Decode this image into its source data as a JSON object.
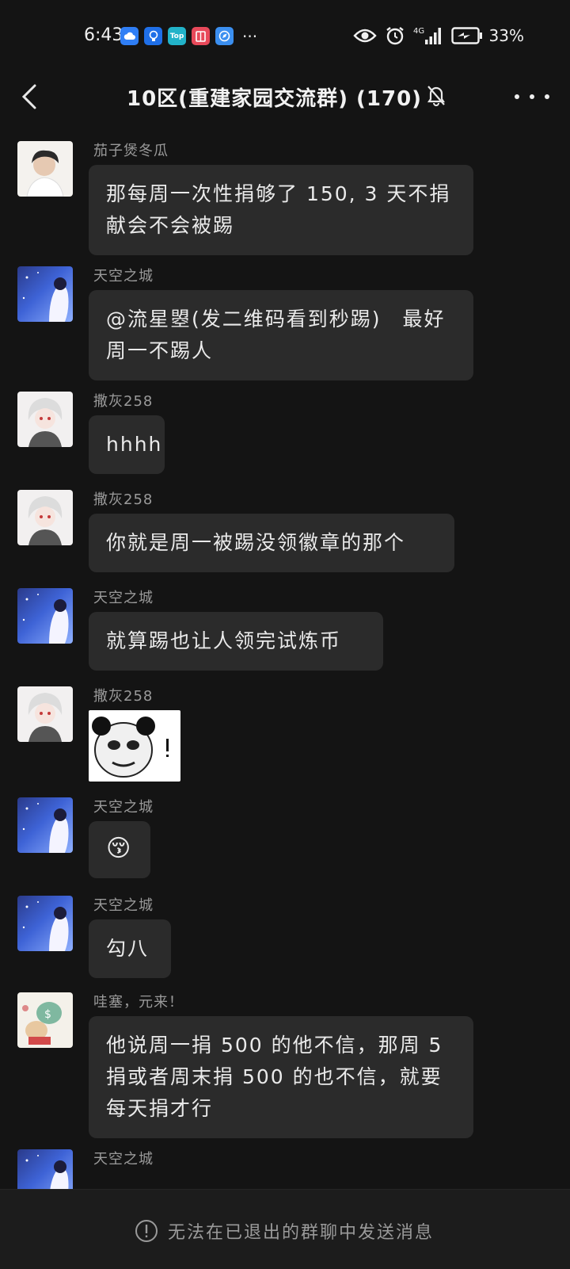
{
  "status_bar": {
    "time": "6:43",
    "network": "4G",
    "battery_text": "33%",
    "app_icons": [
      "cloud-app-icon",
      "lightbulb-app-icon",
      "top-app-icon",
      "notebook-app-icon",
      "compass-app-icon"
    ],
    "more_dots": "···"
  },
  "header": {
    "title": "10区(重建家园交流群) (170)",
    "back_icon": "back-arrow-icon",
    "mute_icon": "bell-off-icon",
    "more_icon": "more-icon"
  },
  "messages": [
    {
      "sender": "茄子煲冬瓜",
      "text": "那每周一次性捐够了 150, 3 天不捐献会不会被踢"
    },
    {
      "sender": "天空之城",
      "text": "@流星曌(发二维码看到秒踢)　最好周一不踢人"
    },
    {
      "sender": "撒灰258",
      "text": "hhhh"
    },
    {
      "sender": "撒灰258",
      "text": "你就是周一被踢没领徽章的那个"
    },
    {
      "sender": "天空之城",
      "text": "就算踢也让人领完试炼币"
    },
    {
      "sender": "撒灰258",
      "text": "",
      "sticker": "panda-meme-sticker"
    },
    {
      "sender": "天空之城",
      "text": "😚"
    },
    {
      "sender": "天空之城",
      "text": "勾八"
    },
    {
      "sender": "哇塞，元来！",
      "text": "他说周一捐 500 的他不信，那周 5 捐或者周末捐 500 的也不信，就要每天捐才行"
    },
    {
      "sender": "天空之城",
      "text": ""
    }
  ],
  "footer": {
    "notice": "无法在已退出的群聊中发送消息",
    "notice_icon": "info-circle-icon"
  },
  "colors": {
    "background": "#141414",
    "bubble": "#2b2b2b",
    "footer": "#1c1c1c",
    "muted_text": "#9a9a9a"
  }
}
